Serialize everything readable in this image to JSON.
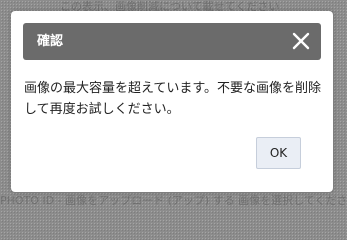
{
  "background": {
    "top_text": "この表示、画像削減について載せてください",
    "bottom_text": "PHOTO ID - 画像をアップロード (アップ) する 画像を選択してください"
  },
  "dialog": {
    "title": "確認",
    "close_icon": "close-icon",
    "message": "画像の最大容量を超えています。不要な画像を削除して再度お試しください。",
    "ok_label": "OK",
    "colors": {
      "header_bg": "#6b6b6b",
      "ok_bg": "#eaeef5"
    }
  }
}
